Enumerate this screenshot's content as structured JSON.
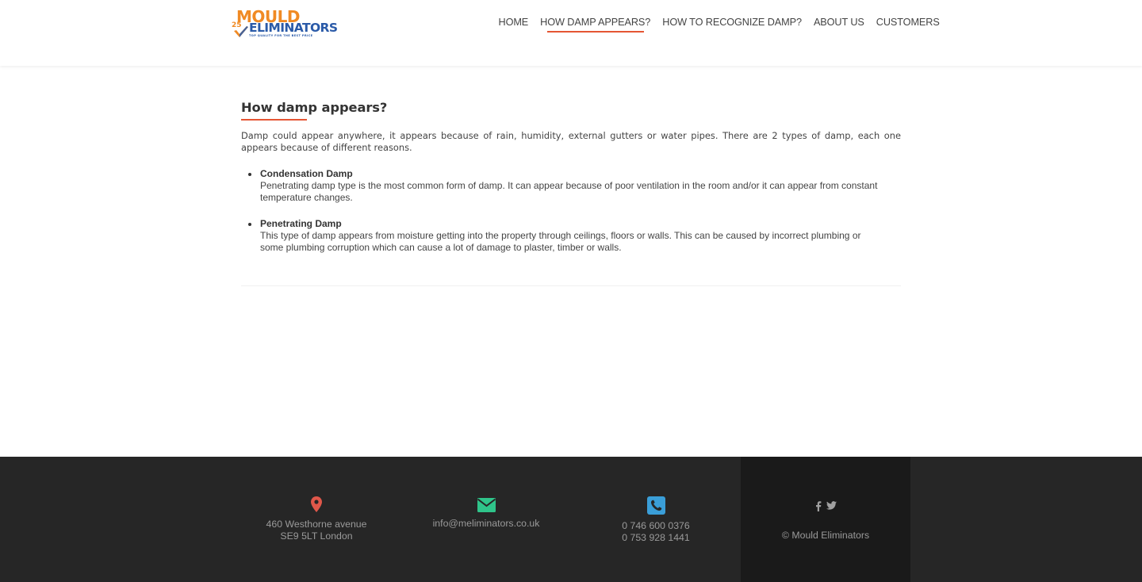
{
  "header": {
    "logo": {
      "line1": "MOULD",
      "line2": "ELIMINATORS",
      "badge": "25",
      "tagline": "TOP QUALITY FOR THE BEST PRICE"
    },
    "nav": [
      "HOME",
      "HOW DAMP APPEARS?",
      "HOW TO RECOGNIZE DAMP?",
      "ABOUT US",
      "CUSTOMERS"
    ],
    "active_nav": "HOW DAMP APPEARS?"
  },
  "main": {
    "title": "How damp appears?",
    "intro": "Damp could appear anywhere, it appears because of rain, humidity, external gutters or water pipes. There are 2 types of damp, each one appears because of different reasons.",
    "items": [
      {
        "title": "Condensation Damp",
        "description": "Penetrating damp type is the most common form of damp. It can appear because of poor ventilation in the room and/or it can appear from constant temperature changes."
      },
      {
        "title": "Penetrating Damp",
        "description": "This type of damp appears from moisture getting into the property through ceilings, floors or walls. This can be caused by incorrect plumbing or some plumbing corruption which can cause a lot of damage to plaster, timber or walls."
      }
    ]
  },
  "footer": {
    "address": [
      "460 Westhorne avenue",
      "SE9 5LT London"
    ],
    "email": "info@meliminators.co.uk",
    "phones": [
      "0 746 600 0376",
      "0 753 928 1441"
    ],
    "social": [
      "facebook-icon",
      "twitter-icon"
    ],
    "copyright": "© Mould Eliminators"
  },
  "colors": {
    "accent": "#e55533",
    "logo_orange": "#f08a24",
    "logo_blue": "#2a5aa8",
    "footer_bg": "#262626",
    "footer_dark": "#1a1a1a",
    "pin": "#e0574a",
    "mail": "#2fc48a",
    "phone": "#3a9ed8"
  }
}
